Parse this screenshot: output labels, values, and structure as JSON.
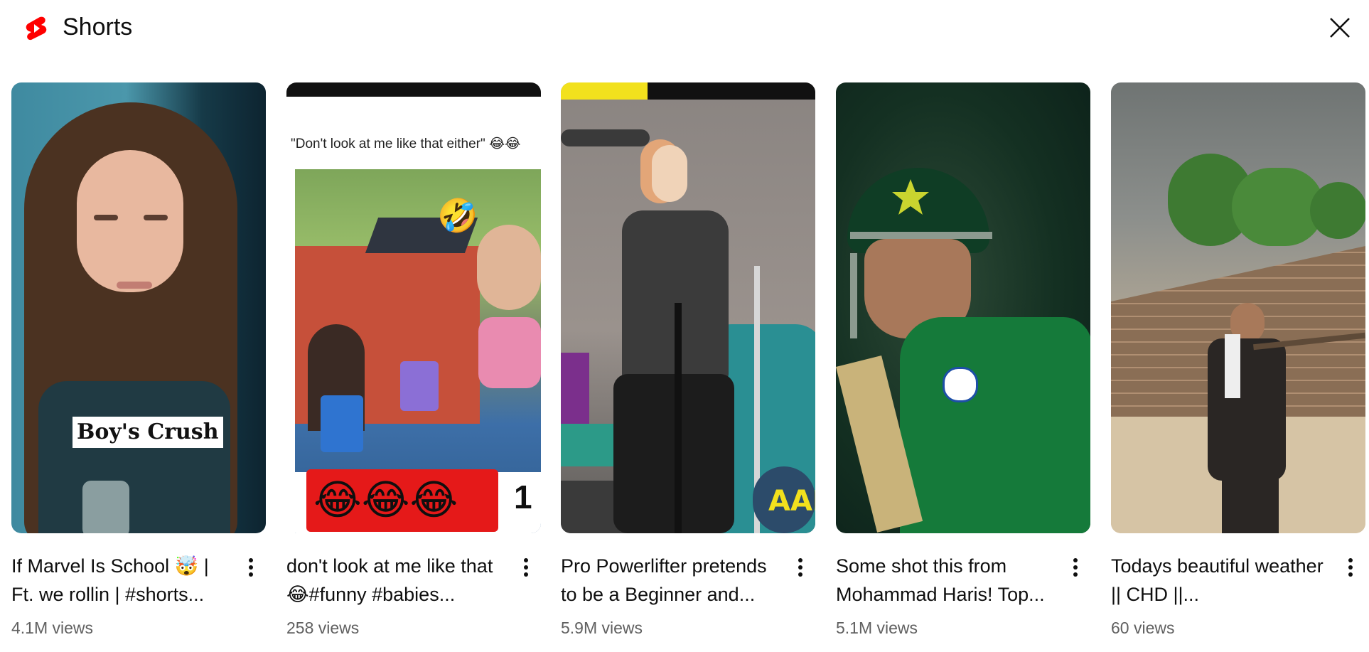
{
  "header": {
    "title": "Shorts",
    "logo_icon": "youtube-shorts-logo-icon",
    "close_icon": "close-icon",
    "brand_color": "#ff0000"
  },
  "shorts": [
    {
      "title": "If Marvel Is School 🤯 | Ft. we rollin | #shorts...",
      "views": "4.1M views",
      "overlay_text": "Boy's Crush"
    },
    {
      "title": "don't look at me like that 😂#funny #babies...",
      "views": "258 views",
      "overlay_text": "\"Don't look at me like that either\" 😂😂",
      "overlay_emojis": "😂😂😂",
      "overlay_suffix": "1"
    },
    {
      "title": "Pro Powerlifter pretends to be a Beginner and...",
      "views": "5.9M views",
      "overlay_text": "AAR"
    },
    {
      "title": "Some shot this from Mohammad Haris! Top...",
      "views": "5.1M views"
    },
    {
      "title": "Todays beautiful weather || CHD ||...",
      "views": "60 views"
    }
  ]
}
